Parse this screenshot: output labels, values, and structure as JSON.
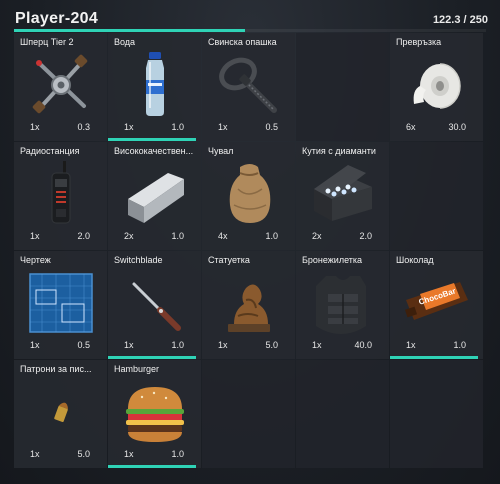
{
  "header": {
    "player_name": "Player-204",
    "weight_text": "122.3 / 250",
    "weight_fraction": 0.49
  },
  "slots": [
    {
      "name": "Шперц Tier 2",
      "count": "1x",
      "weight": "0.3",
      "icon": "lockpick-icon",
      "durability": 0
    },
    {
      "name": "Вода",
      "count": "1x",
      "weight": "1.0",
      "icon": "water-bottle-icon",
      "durability": 0.95
    },
    {
      "name": "Свинска опашка",
      "count": "1x",
      "weight": "0.5",
      "icon": "zip-tie-icon",
      "durability": 0
    },
    {
      "name": "",
      "count": "",
      "weight": "",
      "icon": "",
      "durability": 0
    },
    {
      "name": "Превръзка",
      "count": "6x",
      "weight": "30.0",
      "icon": "bandage-roll-icon",
      "durability": 0
    },
    {
      "name": "Радиостанция",
      "count": "1x",
      "weight": "2.0",
      "icon": "radio-icon",
      "durability": 0
    },
    {
      "name": "Висококачествен...",
      "count": "2x",
      "weight": "1.0",
      "icon": "steel-bar-icon",
      "durability": 0
    },
    {
      "name": "Чувал",
      "count": "4x",
      "weight": "1.0",
      "icon": "sack-icon",
      "durability": 0
    },
    {
      "name": "Кутия с диаманти",
      "count": "2x",
      "weight": "2.0",
      "icon": "diamond-box-icon",
      "durability": 0
    },
    {
      "name": "",
      "count": "",
      "weight": "",
      "icon": "",
      "durability": 0
    },
    {
      "name": "Чертеж",
      "count": "1x",
      "weight": "0.5",
      "icon": "blueprint-icon",
      "durability": 0
    },
    {
      "name": "Switchblade",
      "count": "1x",
      "weight": "1.0",
      "icon": "switchblade-icon",
      "durability": 0.95
    },
    {
      "name": "Статуетка",
      "count": "1x",
      "weight": "5.0",
      "icon": "statuette-icon",
      "durability": 0
    },
    {
      "name": "Бронежилетка",
      "count": "1x",
      "weight": "40.0",
      "icon": "body-armor-icon",
      "durability": 0
    },
    {
      "name": "Шоколад",
      "count": "1x",
      "weight": "1.0",
      "icon": "chocolate-bar-icon",
      "durability": 0.95
    },
    {
      "name": "Патрони за пис...",
      "count": "1x",
      "weight": "5.0",
      "icon": "pistol-ammo-icon",
      "durability": 0
    },
    {
      "name": "Hamburger",
      "count": "1x",
      "weight": "1.0",
      "icon": "hamburger-icon",
      "durability": 0.95
    },
    {
      "name": "",
      "count": "",
      "weight": "",
      "icon": "",
      "durability": 0
    },
    {
      "name": "",
      "count": "",
      "weight": "",
      "icon": "",
      "durability": 0
    },
    {
      "name": "",
      "count": "",
      "weight": "",
      "icon": "",
      "durability": 0
    }
  ],
  "chocolate_wrapper_text": "ChocoBar",
  "accent_color": "#2fd3b6"
}
